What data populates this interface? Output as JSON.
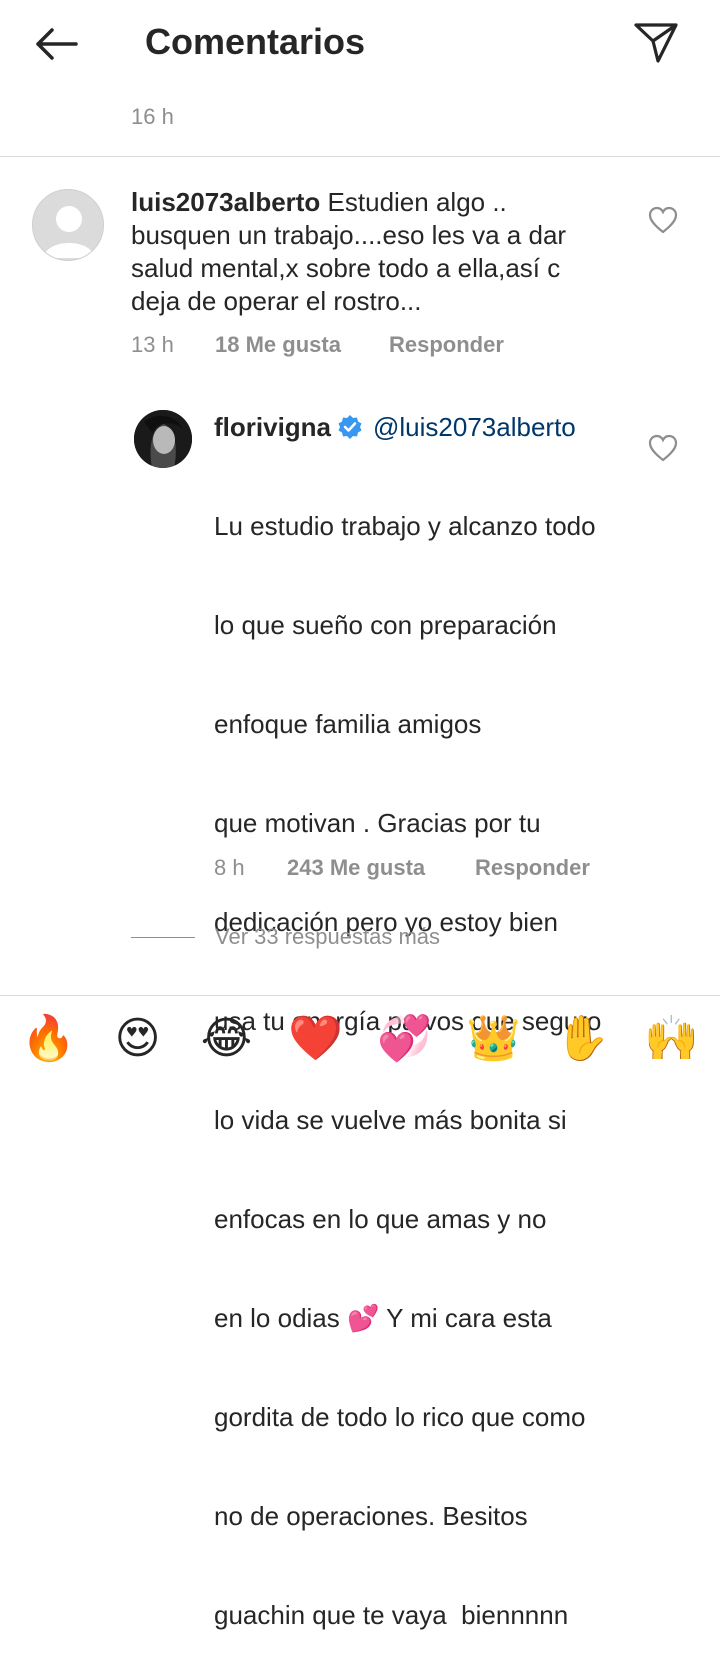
{
  "header": {
    "title": "Comentarios",
    "back_icon": "arrow-left-icon",
    "send_icon": "paper-plane-icon"
  },
  "caption": {
    "time": "16 h"
  },
  "comments": [
    {
      "username": "luis2073alberto",
      "text": "Estudien algo .. busquen un trabajo....eso les va a dar salud mental,x sobre todo a ella,así c deja de operar el rostro...",
      "time": "13 h",
      "likes": "18 Me gusta",
      "reply_label": "Responder"
    }
  ],
  "reply": {
    "username": "florivigna",
    "mention": "@luis2073alberto",
    "lines": [
      "Lu estudio trabajo y alcanzo todo",
      "lo que sueño con preparación",
      "enfoque familia amigos",
      "que motivan . Gracias por tu",
      "dedicación pero yo estoy bien",
      "usa tu energía pa vos que seguro",
      "lo vida se vuelve más bonita si",
      "enfocas en lo que amas y no",
      "en lo odias 💕 Y mi cara esta",
      "gordita de todo lo rico que como",
      "no de operaciones. Besitos",
      "guachin que te vaya  biennnnn"
    ],
    "time": "8 h",
    "likes": "243 Me gusta",
    "reply_label": "Responder"
  },
  "view_more": "Ver 33 respuestas más",
  "emoji_bar": [
    "🔥",
    "😍",
    "😂",
    "❤️",
    "💞",
    "👑",
    "✋",
    "🙌"
  ],
  "colors": {
    "text": "#262626",
    "secondary": "#8e8e8e",
    "mention": "#00376b",
    "verified": "#3897f0"
  }
}
